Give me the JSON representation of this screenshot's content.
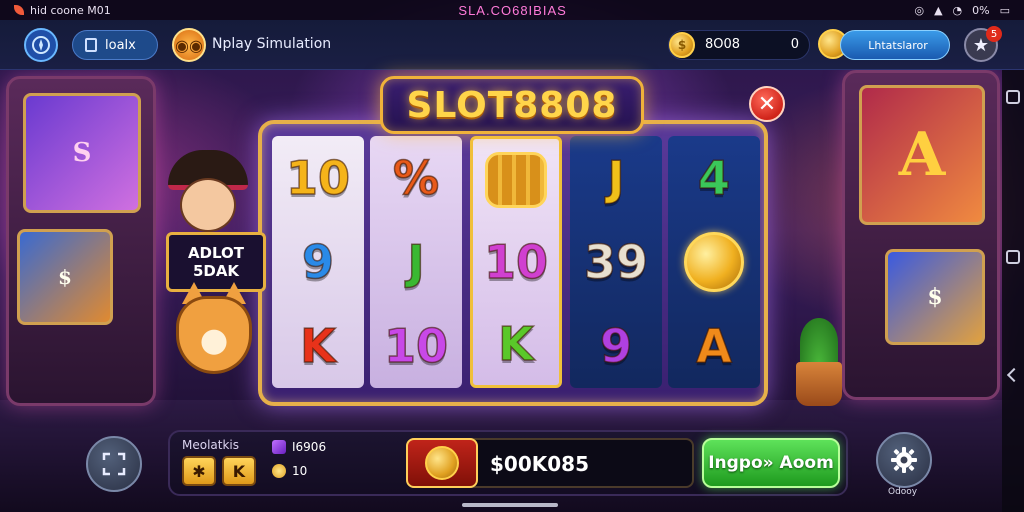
{
  "status_bar": {
    "left_text": "hid coone M01",
    "center_title": "SLA.CO68IBIAS",
    "right_text": "0%"
  },
  "top_bar": {
    "mode_pill_label": "loalx",
    "title": "Nplay Simulation",
    "coin_balance": "8O08",
    "coin_count": "0",
    "action_pill_label": "Lhtatslaror",
    "notification_count": "5"
  },
  "game": {
    "logo_text": "SLOT8808",
    "character_sign_line1": "ADLOT",
    "character_sign_line2": "5DAK",
    "reels": [
      {
        "symbols": [
          {
            "text": "10",
            "color": "#f5b41a"
          },
          {
            "text": "9",
            "color": "#2a8ae8"
          },
          {
            "text": "K",
            "color": "#e8321a"
          }
        ]
      },
      {
        "symbols": [
          {
            "text": "%",
            "color": "#e85a1a"
          },
          {
            "text": "J",
            "color": "#3ab832"
          },
          {
            "text": "10",
            "color": "#c848e8"
          }
        ]
      },
      {
        "symbols": [
          {
            "text": "",
            "icon": "barrel-icon"
          },
          {
            "text": "10",
            "color": "#d040d0"
          },
          {
            "text": "K",
            "color": "#5ac82a"
          }
        ]
      },
      {
        "symbols": [
          {
            "text": "J",
            "color": "#f0c01a"
          },
          {
            "text": "39",
            "color": "#e8e0d0"
          },
          {
            "text": "9",
            "color": "#b040e0"
          }
        ]
      },
      {
        "symbols": [
          {
            "text": "4",
            "color": "#3ac85a"
          },
          {
            "text": "",
            "icon": "gold-coin-icon"
          },
          {
            "text": "A",
            "color": "#f08a1a"
          }
        ]
      }
    ]
  },
  "bottom_bar": {
    "panel_label": "Meolatkis",
    "gem_value": "I6906",
    "coin_value": "10",
    "win_amount": "$00K085",
    "spin_button_label": "Ingpo» Aoom",
    "settings_label": "Odooy"
  },
  "colors": {
    "accent_gold": "#f0b23a",
    "spin_green": "#3ac83a",
    "close_red": "#d0241a",
    "topbar_blue": "#1a1f44"
  }
}
